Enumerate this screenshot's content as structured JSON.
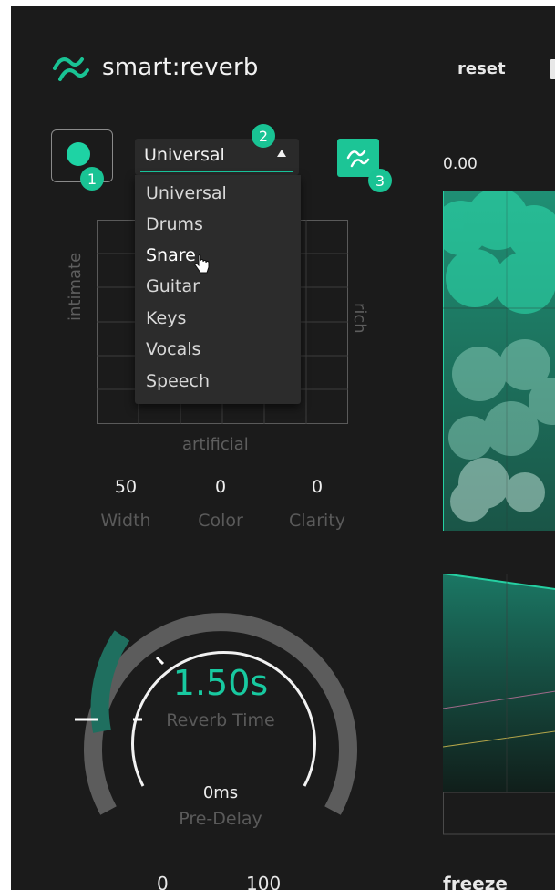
{
  "header": {
    "app_name": "smart:reverb",
    "reset_label": "reset",
    "logo_icon": "waves-logo-icon"
  },
  "profile_dropdown": {
    "selected": "Universal",
    "items": [
      "Universal",
      "Drums",
      "Snare",
      "Guitar",
      "Keys",
      "Vocals",
      "Speech"
    ],
    "hovered": "Snare"
  },
  "badges": {
    "one": "1",
    "two": "2",
    "three": "3"
  },
  "character_grid": {
    "left_label": "intimate",
    "right_label": "rich",
    "bottom_label": "artificial"
  },
  "params": [
    {
      "value": "50",
      "label": "Width"
    },
    {
      "value": "0",
      "label": "Color"
    },
    {
      "value": "0",
      "label": "Clarity"
    }
  ],
  "knob": {
    "reverb_time_value": "1.50s",
    "reverb_time_label": "Reverb Time",
    "predelay_value": "0ms",
    "predelay_label": "Pre-Delay"
  },
  "visualization": {
    "readout": "0.00"
  },
  "bottom_partial": {
    "a": "0",
    "b": "100",
    "c": "freeze"
  },
  "colors": {
    "accent": "#18c9a0",
    "background": "#1b1b1b",
    "dim_text": "#5a5a5a"
  }
}
